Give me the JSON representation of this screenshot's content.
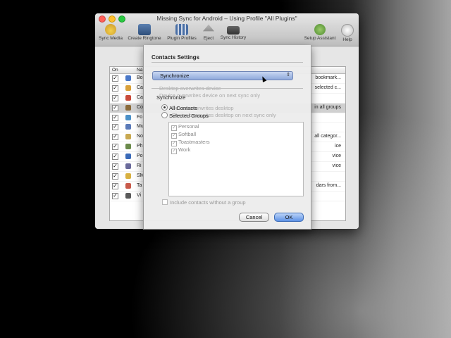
{
  "window": {
    "title": "Missing Sync for Android – Using Profile \"All Plugins\"",
    "toolbar": [
      {
        "label": "Sync Media",
        "icon": "sync-media-icon"
      },
      {
        "label": "Create Ringtone",
        "icon": "ringtone-icon"
      },
      {
        "label": "Plugin Profiles",
        "icon": "plugin-profiles-icon"
      },
      {
        "label": "Eject",
        "icon": "eject-icon"
      },
      {
        "label": "Sync History",
        "icon": "sync-history-icon"
      },
      {
        "label": "Setup Assistant",
        "icon": "setup-assistant-icon"
      },
      {
        "label": "Help",
        "icon": "help-icon"
      }
    ]
  },
  "table": {
    "columns": {
      "on": "On",
      "name": "Na"
    },
    "rows": [
      {
        "name": "Bo",
        "desc": "bookmark...",
        "checked": true
      },
      {
        "name": "Ca",
        "desc": "selected c...",
        "checked": true
      },
      {
        "name": "Ca",
        "desc": "",
        "checked": true
      },
      {
        "name": "Co",
        "desc": "in all groups",
        "checked": true,
        "selected": true
      },
      {
        "name": "Fo",
        "desc": "",
        "checked": true
      },
      {
        "name": "Mu",
        "desc": "",
        "checked": true
      },
      {
        "name": "No",
        "desc": "all categor...",
        "checked": true
      },
      {
        "name": "Ph",
        "desc": "ice",
        "checked": true
      },
      {
        "name": "Po",
        "desc": "vice",
        "checked": true
      },
      {
        "name": "Ri",
        "desc": "vice",
        "checked": true
      },
      {
        "name": "SM",
        "desc": "",
        "checked": true
      },
      {
        "name": "Ta",
        "desc": "dars from...",
        "checked": true
      },
      {
        "name": "Vi",
        "desc": "",
        "checked": true
      }
    ]
  },
  "sheet": {
    "title": "Contacts Settings",
    "popup_value": "Synchronize",
    "ghost_lines": [
      "Desktop overwrites device",
      "Device overwrites device on next sync only",
      "Device overwrites desktop",
      "Device overwrites desktop on next sync only"
    ],
    "synchronize_label": "Synchronize",
    "radio_all": "All Contacts",
    "radio_selected": "Selected Groups",
    "groups": [
      "Personal",
      "Softball",
      "Toastmasters",
      "Work"
    ],
    "include_label": "Include contacts without a group",
    "cancel_label": "Cancel",
    "ok_label": "OK"
  }
}
